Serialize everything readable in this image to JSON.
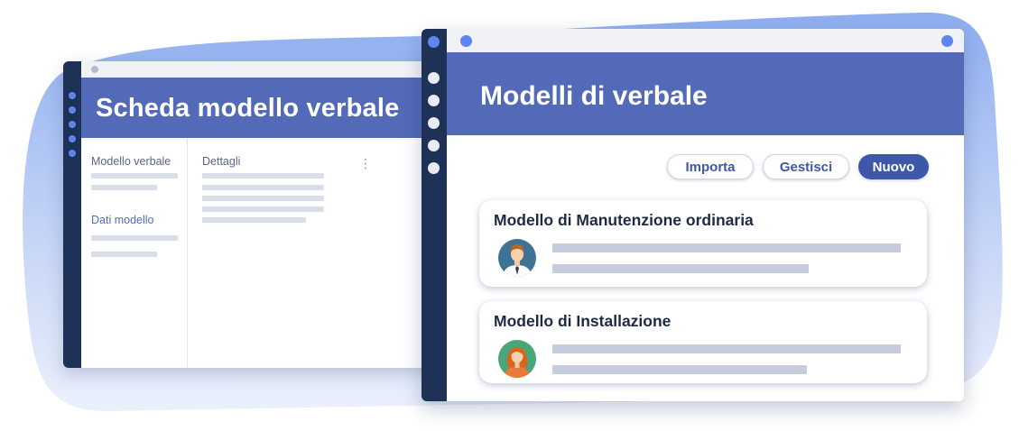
{
  "colors": {
    "rail": "#1e3157",
    "header": "#526ab7",
    "accent": "#3d58a8",
    "dot_blue": "#5d86ee",
    "placeholder": "#d9dee9",
    "background_blob": "#a9c2f4"
  },
  "back_window": {
    "title": "Scheda modello verbale",
    "sidebar_sections": [
      {
        "label": "Modello verbale"
      },
      {
        "label": "Dati modello"
      }
    ],
    "details_label": "Dettagli",
    "menu_icon": "kebab-menu-icon"
  },
  "front_window": {
    "title": "Modelli di verbale",
    "toolbar": {
      "import_label": "Importa",
      "manage_label": "Gestisci",
      "new_label": "Nuovo"
    },
    "cards": [
      {
        "title": "Modello di Manutenzione ordinaria",
        "avatar_icon": "male-user-avatar-icon"
      },
      {
        "title": "Modello di Installazione",
        "avatar_icon": "female-user-avatar-icon"
      }
    ]
  }
}
